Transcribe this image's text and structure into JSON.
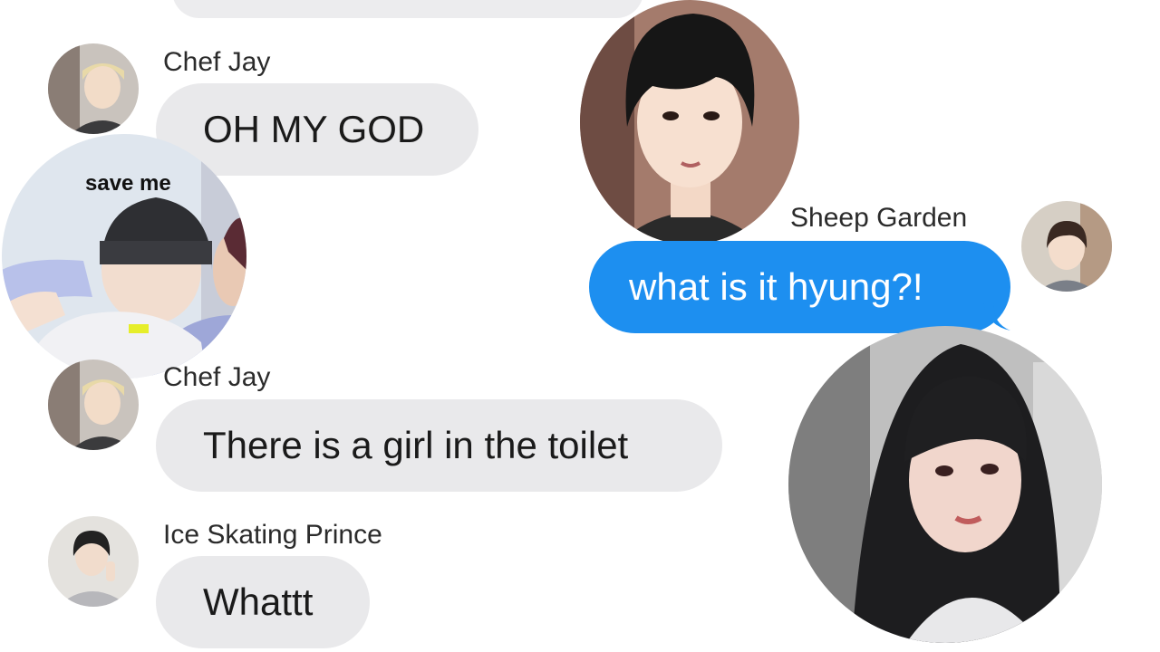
{
  "messages": [
    {
      "sender": "Chef Jay",
      "text": "OH MY GOD",
      "direction": "incoming"
    },
    {
      "sender": "Sheep Garden",
      "text": "what is it hyung?!",
      "direction": "outgoing"
    },
    {
      "sender": "Chef Jay",
      "text": "There is a girl in the toilet",
      "direction": "incoming"
    },
    {
      "sender": "Ice Skating Prince",
      "text": "Whattt",
      "direction": "incoming"
    }
  ],
  "stickers": {
    "save_me_label": "save me"
  },
  "colors": {
    "incoming_bubble": "#e9e9eb",
    "outgoing_bubble": "#1d8ff0",
    "outgoing_text": "#ffffff",
    "background": "#ffffff"
  }
}
